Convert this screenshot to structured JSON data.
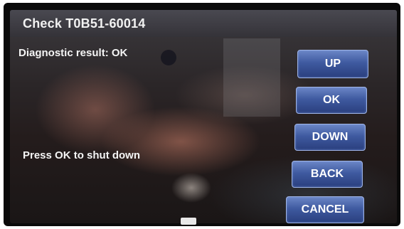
{
  "header": {
    "title": "Check T0B51-60014"
  },
  "main": {
    "result_text": "Diagnostic result: OK",
    "hint_text": "Press OK to shut down"
  },
  "buttons": {
    "up": "UP",
    "ok": "OK",
    "down": "DOWN",
    "back": "BACK",
    "cancel": "CANCEL"
  },
  "colors": {
    "button_top": "#6b86c6",
    "button_bottom": "#2a3f7e",
    "text": "#f5f5f5"
  }
}
